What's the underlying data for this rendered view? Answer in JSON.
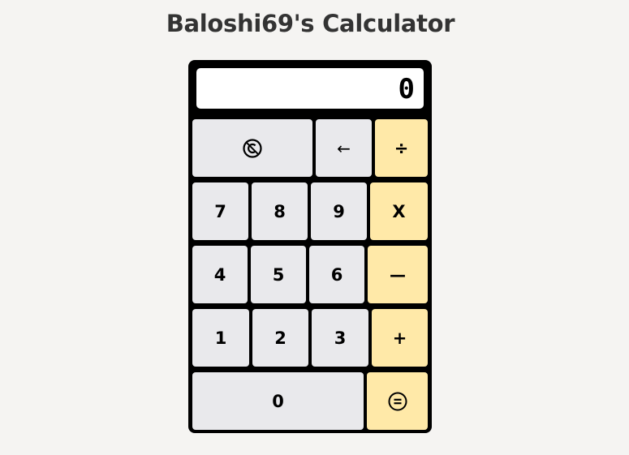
{
  "app": {
    "title": "Baloshi69's Calculator"
  },
  "display": {
    "value": "0"
  },
  "buttons": {
    "clear": {
      "icon": "circled-c-icon"
    },
    "backspace": {
      "label": "←"
    },
    "divide": {
      "label": "÷"
    },
    "seven": {
      "label": "7"
    },
    "eight": {
      "label": "8"
    },
    "nine": {
      "label": "9"
    },
    "multiply": {
      "label": "X"
    },
    "four": {
      "label": "4"
    },
    "five": {
      "label": "5"
    },
    "six": {
      "label": "6"
    },
    "subtract": {
      "label": "—"
    },
    "one": {
      "label": "1"
    },
    "two": {
      "label": "2"
    },
    "three": {
      "label": "3"
    },
    "add": {
      "label": "+"
    },
    "zero": {
      "label": "0"
    },
    "equals": {
      "icon": "circled-equals-icon"
    }
  },
  "colors": {
    "background": "#f5f4f2",
    "frame": "#000000",
    "key": "#e9e9ec",
    "operator_key": "#ffe9a8",
    "title_text": "#333333"
  }
}
